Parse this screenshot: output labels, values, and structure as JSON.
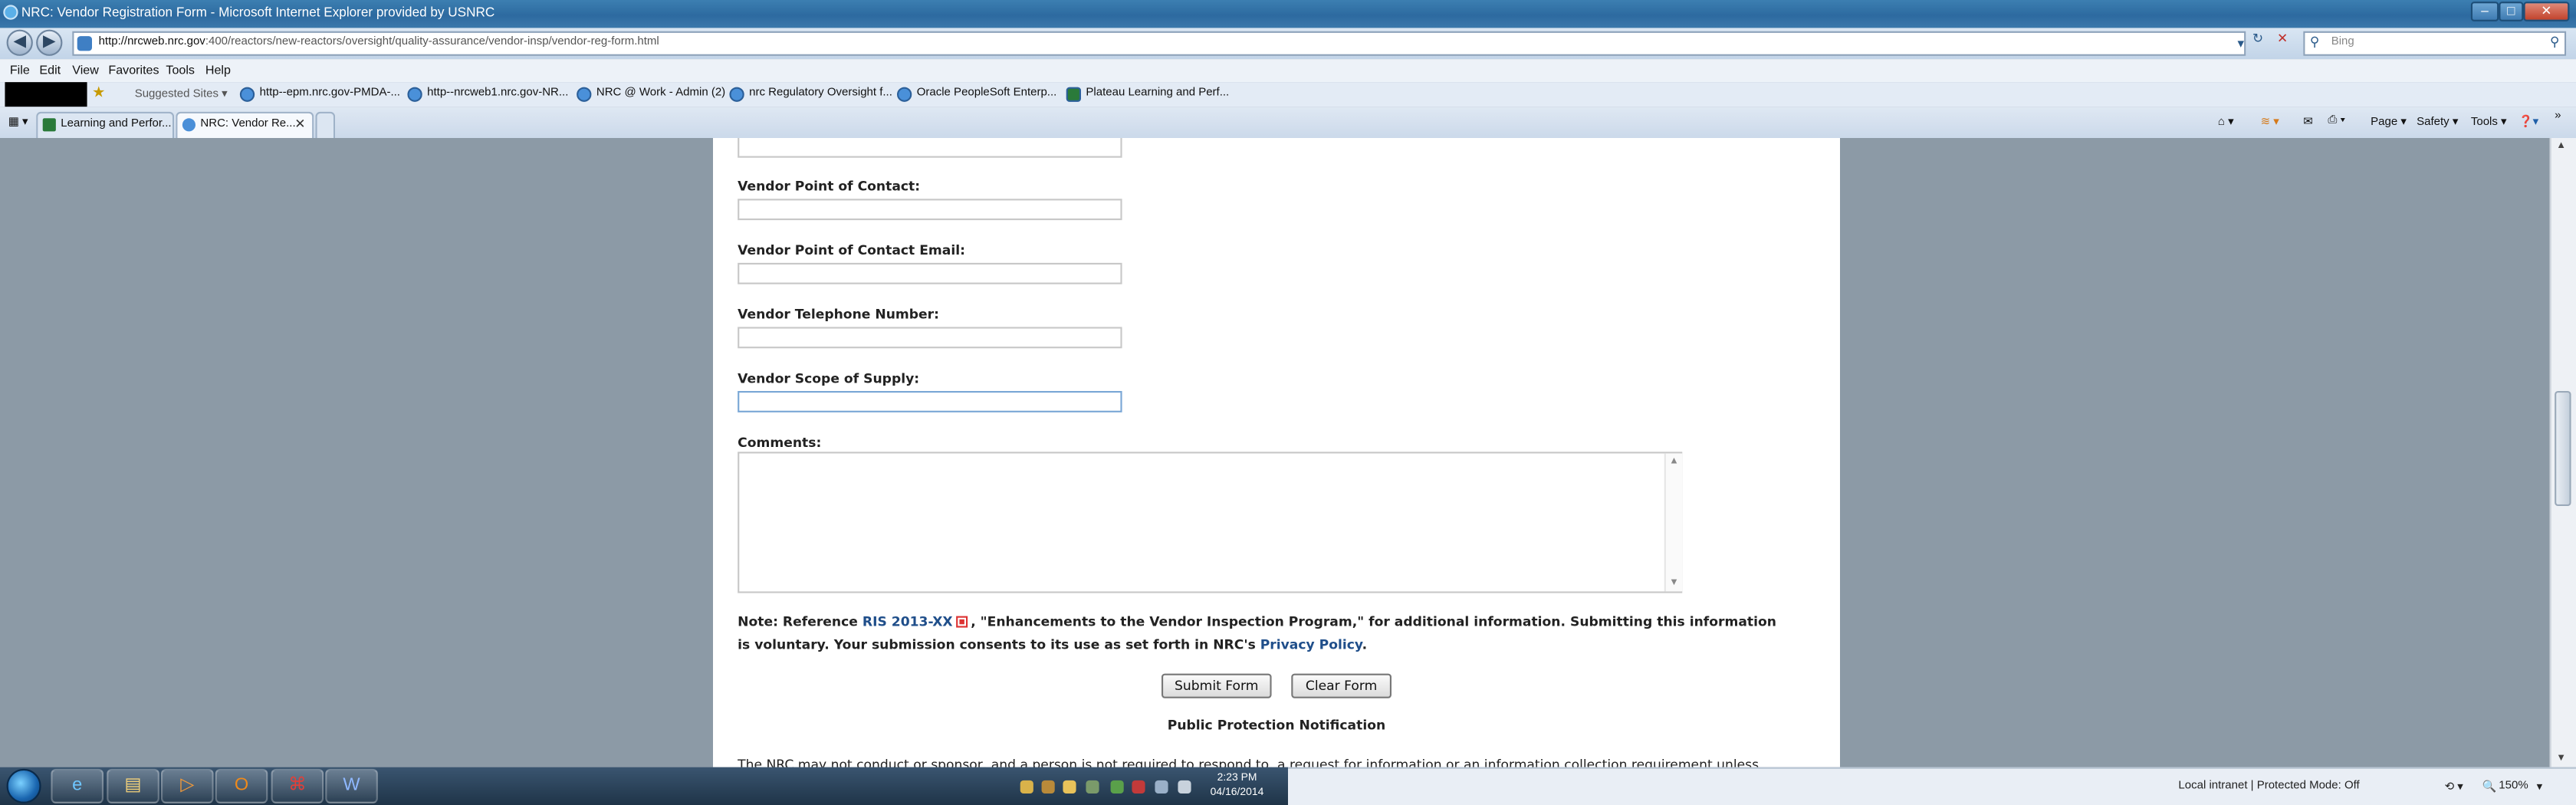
{
  "window": {
    "title": "NRC: Vendor Registration Form - Microsoft Internet Explorer provided by USNRC"
  },
  "address": {
    "url_host": "http://nrcweb.nrc.gov",
    "url_path": ":400/reactors/new-reactors/oversight/quality-assurance/vendor-insp/vendor-reg-form.html",
    "search_placeholder": "Bing"
  },
  "menu": [
    "File",
    "Edit",
    "View",
    "Favorites",
    "Tools",
    "Help"
  ],
  "favorites": [
    "Suggested Sites ▾",
    "http--epm.nrc.gov-PMDA-...",
    "http--nrcweb1.nrc.gov-NR...",
    "NRC @ Work - Admin (2)",
    "nrc Regulatory Oversight f...",
    "Oracle  PeopleSoft Enterp...",
    "Plateau Learning and Perf..."
  ],
  "tabs": [
    {
      "label": "Learning and Perfor..."
    },
    {
      "label": "NRC: Vendor Re..."
    }
  ],
  "command_bar": {
    "page": "Page ▾",
    "safety": "Safety ▾",
    "tools": "Tools ▾"
  },
  "form": {
    "fields": [
      {
        "label": "Vendor Point of Contact:"
      },
      {
        "label": "Vendor Point of Contact Email:"
      },
      {
        "label": "Vendor Telephone Number:"
      },
      {
        "label": "Vendor Scope of Supply:"
      }
    ],
    "comments_label": "Comments:",
    "note_prefix": "Note: Reference ",
    "note_link": "RIS 2013-XX",
    "note_middle": ", \"Enhancements to the Vendor Inspection Program,\" for additional information. Submitting this information is voluntary. Your submission consents to its use as set forth in NRC's ",
    "privacy_link": "Privacy Policy",
    "note_end": ".",
    "submit_label": "Submit Form",
    "clear_label": "Clear Form",
    "ppn_heading": "Public Protection Notification",
    "disclaimer": "The NRC may not conduct or sponsor, and a person is not required to respond to, a request for information or an information collection requirement unless"
  },
  "taskbar": {
    "time": "2:23 PM",
    "date": "04/16/2014"
  },
  "status": {
    "zone": "Local intranet | Protected Mode: Off",
    "zoom": "150%"
  }
}
